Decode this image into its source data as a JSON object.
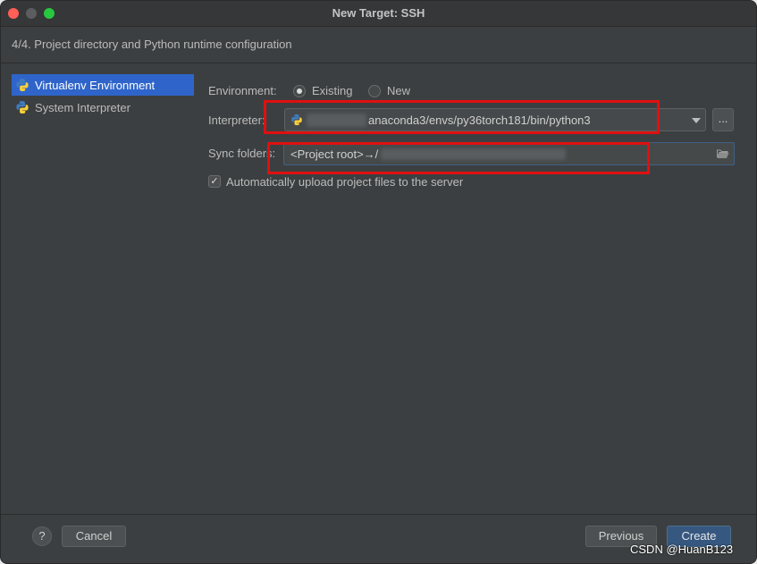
{
  "window": {
    "title": "New Target: SSH",
    "step_text": "4/4. Project directory and Python runtime configuration"
  },
  "sidebar": {
    "items": [
      {
        "label": "Virtualenv Environment",
        "selected": true,
        "icon": "python-icon"
      },
      {
        "label": "System Interpreter",
        "selected": false,
        "icon": "python-icon"
      }
    ]
  },
  "form": {
    "environment_label": "Environment:",
    "environment_options": [
      {
        "label": "Existing",
        "checked": true
      },
      {
        "label": "New",
        "checked": false
      }
    ],
    "interpreter_label": "Interpreter:",
    "interpreter_value": "anaconda3/envs/py36torch181/bin/python3",
    "browse_label": "...",
    "sync_label": "Sync folders:",
    "sync_value": "<Project root>→/",
    "auto_upload_label": "Automatically upload project files to the server",
    "auto_upload_checked": true
  },
  "footer": {
    "help_label": "?",
    "cancel_label": "Cancel",
    "previous_label": "Previous",
    "create_label": "Create"
  },
  "watermark": "CSDN @HuanB123",
  "colors": {
    "accent": "#2f65ca",
    "highlight_box": "#e01010",
    "primary_button": "#365880"
  }
}
